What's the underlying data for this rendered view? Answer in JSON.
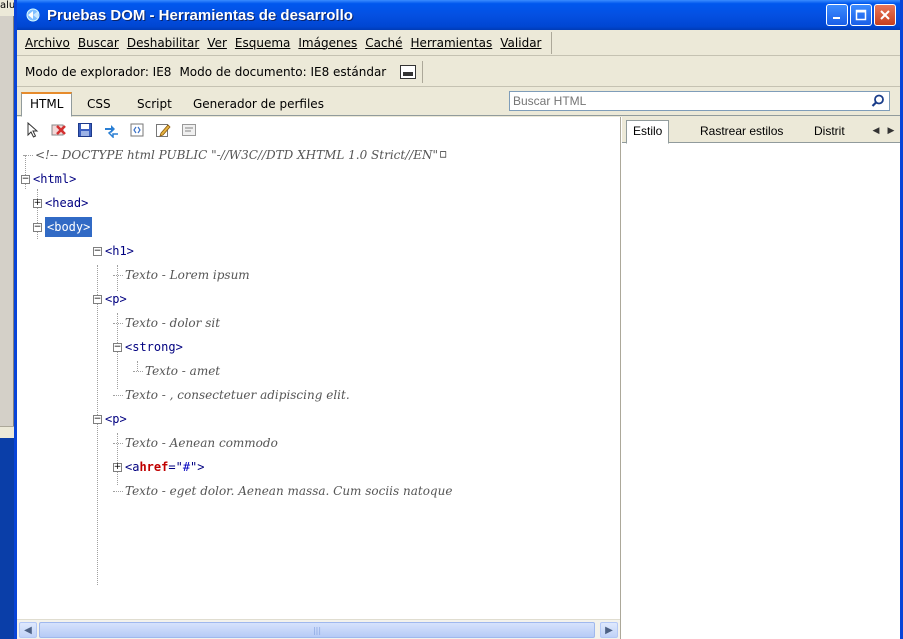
{
  "background": {
    "fragment_text": "alu"
  },
  "window": {
    "title": "Pruebas DOM - Herramientas de desarrollo",
    "title_color": "#0450e2"
  },
  "menu": {
    "items": [
      {
        "label": "Archivo"
      },
      {
        "label": "Buscar"
      },
      {
        "label": "Deshabilitar"
      },
      {
        "label": "Ver"
      },
      {
        "label": "Esquema"
      },
      {
        "label": "Imágenes"
      },
      {
        "label": "Caché"
      },
      {
        "label": "Herramientas"
      },
      {
        "label": "Validar"
      }
    ]
  },
  "modes": {
    "browser_mode": "Modo de explorador: IE8",
    "document_mode": "Modo de documento: IE8 estándar"
  },
  "tabs": [
    {
      "label": "HTML",
      "active": true
    },
    {
      "label": "CSS"
    },
    {
      "label": "Script"
    },
    {
      "label": "Generador de perfiles"
    }
  ],
  "search": {
    "placeholder": "Buscar HTML"
  },
  "tree": {
    "doctype": "<!-- DOCTYPE html PUBLIC \"-//W3C//DTD XHTML 1.0 Strict//EN\"",
    "html": "<html>",
    "head": "<head>",
    "body": "<body>",
    "h1": "<h1>",
    "h1_text": "Texto - Lorem ipsum",
    "p1": "<p>",
    "p1_text1": "Texto - dolor sit",
    "strong": "<strong>",
    "strong_text": "Texto - amet",
    "p1_text2": "Texto - , consectetuer adipiscing elit.",
    "p2": "<p>",
    "p2_text1": "Texto - Aenean commodo",
    "a_open": "<a ",
    "a_attr": "href",
    "a_eq": "=\"",
    "a_val": "#",
    "a_close": "\">",
    "p2_text2": "Texto -  eget dolor. Aenean massa. Cum sociis natoque"
  },
  "right_tabs": [
    {
      "label": "Estilo",
      "active": true
    },
    {
      "label": "Rastrear estilos"
    },
    {
      "label": "Distrit"
    }
  ]
}
